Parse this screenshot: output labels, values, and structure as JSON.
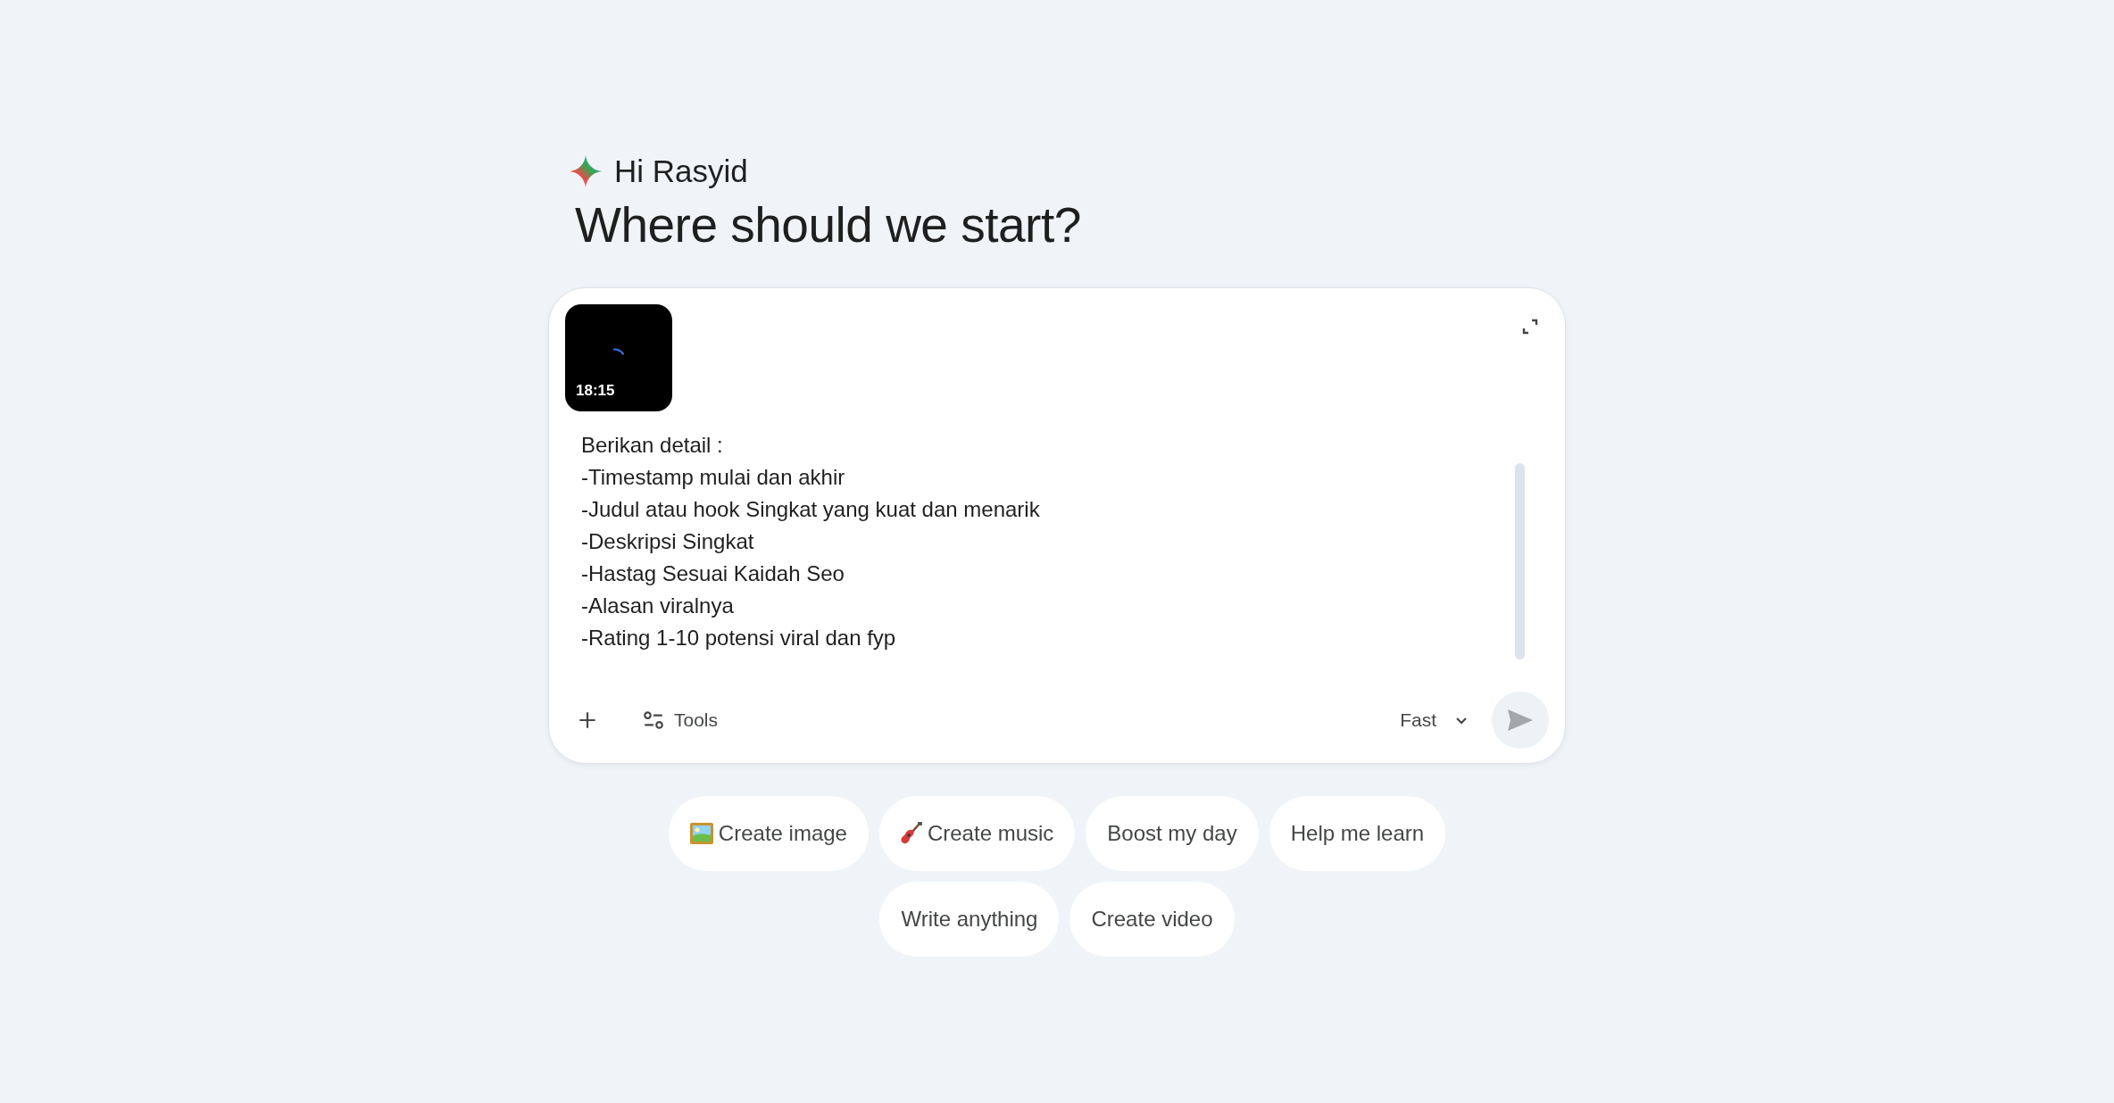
{
  "greeting": "Hi Rasyid",
  "heading": "Where should we start?",
  "composer": {
    "attachment": {
      "duration": "18:15"
    },
    "prompt_lines": [
      "Berikan detail :",
      "-Timestamp mulai dan akhir",
      "-Judul atau hook Singkat yang kuat dan menarik",
      "-Deskripsi Singkat",
      "-Hastag Sesuai Kaidah Seo",
      "-Alasan viralnya",
      "-Rating 1-10 potensi viral dan fyp"
    ],
    "tools_label": "Tools",
    "model": "Fast",
    "send_disabled": true
  },
  "suggestions": [
    [
      {
        "label": "Create image",
        "kind": "image"
      },
      {
        "label": "Create music",
        "kind": "music"
      },
      {
        "label": "Boost my day",
        "kind": "text"
      },
      {
        "label": "Help me learn",
        "kind": "text"
      }
    ],
    [
      {
        "label": "Write anything",
        "kind": "text"
      },
      {
        "label": "Create video",
        "kind": "text"
      }
    ]
  ]
}
